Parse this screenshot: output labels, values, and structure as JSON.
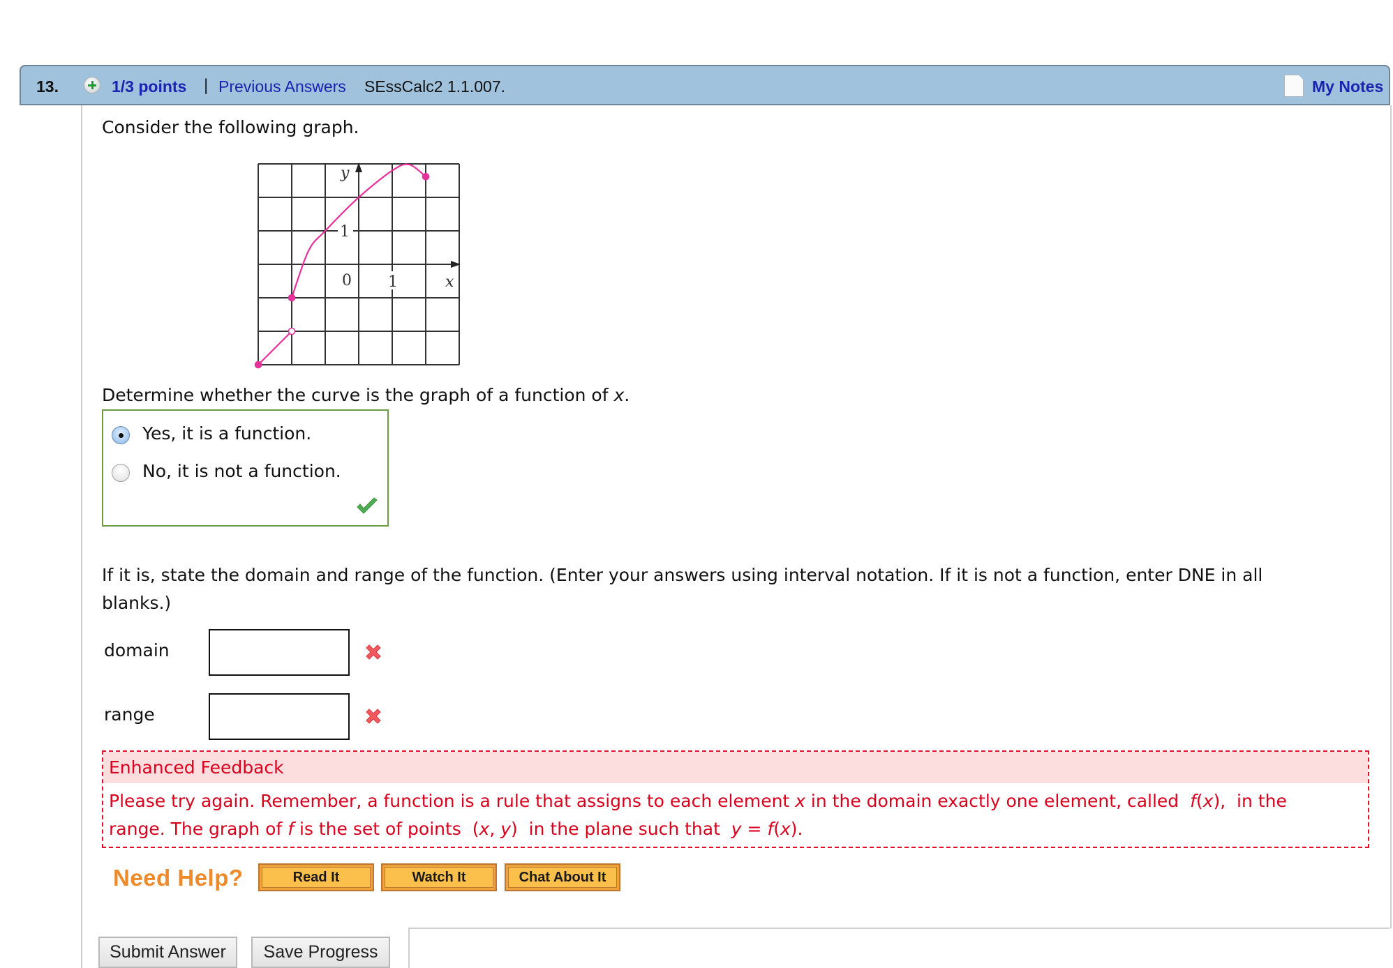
{
  "header": {
    "question_number": "13.",
    "points": "1/3 points",
    "separator": "|",
    "previous_answers": "Previous Answers",
    "problem_ref": "SEssCalc2 1.1.007.",
    "my_notes": "My Notes"
  },
  "question": {
    "intro": "Consider the following graph.",
    "part1_prompt": "Determine whether the curve is the graph of a function of ",
    "part1_var": "x",
    "part1_end": ".",
    "options": [
      {
        "label": "Yes, it is a function.",
        "selected": true
      },
      {
        "label": "No, it is not a function.",
        "selected": false
      }
    ],
    "part1_status": "correct",
    "instructions_line1": "If it is, state the domain and range of the function. (Enter your answers using interval notation. If it is not a function, enter DNE in all",
    "instructions_line2": "blanks.)",
    "fields": [
      {
        "label": "domain",
        "value": "",
        "status": "incorrect"
      },
      {
        "label": "range",
        "value": "",
        "status": "incorrect"
      }
    ]
  },
  "graph": {
    "x_label": "x",
    "y_label": "y",
    "tick_x": "1",
    "tick_y": "1",
    "origin": "0",
    "x_range": [
      -3,
      3
    ],
    "y_range": [
      -3,
      3
    ],
    "curve_color": "#e8309a",
    "segment1": {
      "from": [
        -3,
        -3
      ],
      "to": [
        -2,
        -2
      ],
      "from_closed": true,
      "to_closed": false
    },
    "segment2": {
      "points": [
        [
          -2,
          -1
        ],
        [
          -1.5,
          0.4
        ],
        [
          -1,
          1
        ],
        [
          0,
          2
        ],
        [
          1,
          2.8
        ],
        [
          1.5,
          2.98
        ],
        [
          2,
          2.62
        ]
      ],
      "start_closed": true,
      "end_closed": true
    }
  },
  "feedback": {
    "title": "Enhanced Feedback",
    "line1_a": "Please try again. Remember, a function is a rule that assigns to each element ",
    "line1_x": "x",
    "line1_b": " in the domain exactly one element, called ",
    "line1_fx_f": "f",
    "line1_fx_open": "(",
    "line1_fx_x": "x",
    "line1_fx_close": "),",
    "line1_c": " in the",
    "line2_a": "range. The graph of ",
    "line2_f": "f",
    "line2_b": " is the set of points ",
    "line2_pt_open": "(",
    "line2_pt_x": "x",
    "line2_pt_comma": ", ",
    "line2_pt_y": "y",
    "line2_pt_close": ")",
    "line2_c": " in the plane such that ",
    "line2_y": "y",
    "line2_eq": " = ",
    "line2_f2": "f",
    "line2_open2": "(",
    "line2_x2": "x",
    "line2_close2": ")."
  },
  "help": {
    "title": "Need Help?",
    "buttons": [
      "Read It",
      "Watch It",
      "Chat About It"
    ]
  },
  "actions": {
    "submit": "Submit Answer",
    "save": "Save Progress"
  },
  "colors": {
    "header_bg": "#a1c2dc",
    "link": "#1a24b0",
    "correct": "#6a9b3e",
    "error": "#d8001c",
    "help": "#ef8a2b"
  }
}
